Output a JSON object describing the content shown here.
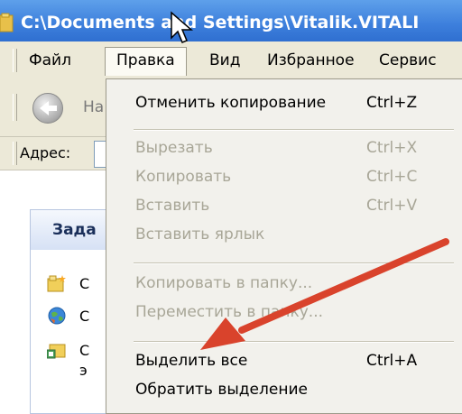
{
  "window": {
    "title": "C:\\Documents and Settings\\Vitalik.VITALI"
  },
  "menubar": {
    "items": [
      "Файл",
      "Правка",
      "Вид",
      "Избранное",
      "Сервис"
    ],
    "active_index": 1
  },
  "toolbar": {
    "back_label": "На"
  },
  "addressbar": {
    "label": "Адрес:"
  },
  "taskpane": {
    "header": "Зада",
    "items": [
      {
        "icon": "new-folder-icon",
        "text": "С"
      },
      {
        "icon": "globe-icon",
        "text": "С"
      },
      {
        "icon": "share-folder-icon",
        "text": "С",
        "text2": "э"
      }
    ]
  },
  "edit_menu": {
    "groups": [
      [
        {
          "label": "Отменить копирование",
          "shortcut": "Ctrl+Z",
          "enabled": true
        }
      ],
      [
        {
          "label": "Вырезать",
          "shortcut": "Ctrl+X",
          "enabled": false
        },
        {
          "label": "Копировать",
          "shortcut": "Ctrl+C",
          "enabled": false
        },
        {
          "label": "Вставить",
          "shortcut": "Ctrl+V",
          "enabled": false
        },
        {
          "label": "Вставить ярлык",
          "shortcut": "",
          "enabled": false
        }
      ],
      [
        {
          "label": "Копировать в папку...",
          "shortcut": "",
          "enabled": false
        },
        {
          "label": "Переместить в папку...",
          "shortcut": "",
          "enabled": false
        }
      ],
      [
        {
          "label": "Выделить все",
          "shortcut": "Ctrl+A",
          "enabled": true
        },
        {
          "label": "Обратить выделение",
          "shortcut": "",
          "enabled": true
        }
      ]
    ]
  },
  "colors": {
    "titlebar": "#3d7fdc",
    "menu_bg": "#f2f1ec",
    "disabled_text": "#a8a697",
    "annotation_arrow": "#d9432c"
  }
}
